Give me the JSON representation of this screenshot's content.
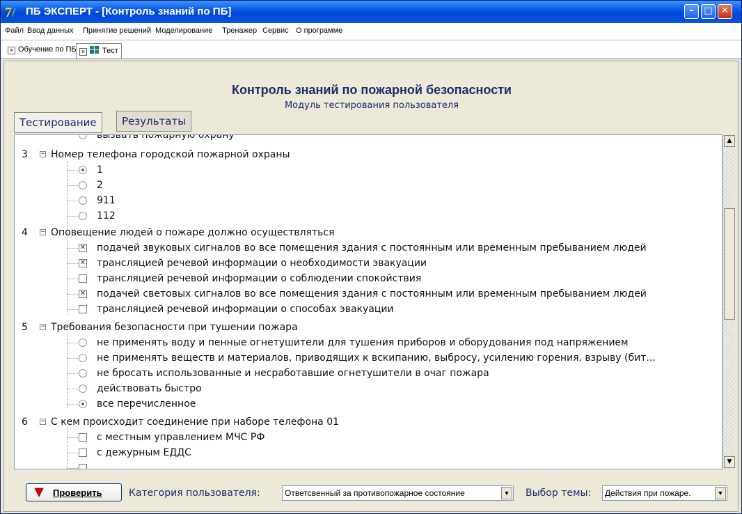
{
  "window": {
    "title": "ПБ ЭКСПЕРТ - [Контроль знаний по ПБ]",
    "minimize": "–",
    "maximize": "□",
    "close": "✕"
  },
  "menu": [
    "Файл",
    "Ввод данных",
    "Принятие решений",
    "Моделирование",
    "Тренажер",
    "Сервис",
    "О программе"
  ],
  "doc_tabs": [
    {
      "label": "Обучение по ПБ",
      "active": false
    },
    {
      "label": "Тест",
      "active": true
    }
  ],
  "header": {
    "title": "Контроль знаний по пожарной безопасности",
    "subtitle": "Модуль тестирования пользователя"
  },
  "mode_tabs": [
    {
      "label": "Тестирование",
      "active": true
    },
    {
      "label": "Результаты",
      "active": false
    }
  ],
  "tree": {
    "partial_top": "вызвать пожарную охрану",
    "questions": [
      {
        "num": "3",
        "text": "Номер телефона городской пожарной охраны",
        "type": "radio",
        "options": [
          {
            "text": "1",
            "checked": true
          },
          {
            "text": "2",
            "checked": false
          },
          {
            "text": "911",
            "checked": false
          },
          {
            "text": "112",
            "checked": false
          }
        ]
      },
      {
        "num": "4",
        "text": "Оповещение людей о пожаре должно осуществляться",
        "type": "checkbox",
        "options": [
          {
            "text": "подачей звуковых сигналов во все помещения здания с постоянным или временным пребыванием людей",
            "checked": true
          },
          {
            "text": "трансляцией речевой информации о необходимости эвакуации",
            "checked": true
          },
          {
            "text": "трансляцией речевой информации о соблюдении спокойствия",
            "checked": false
          },
          {
            "text": "подачей световых сигналов во все помещения здания с постоянным или временным пребыванием людей",
            "checked": true
          },
          {
            "text": "трансляцией речевой информации о способах эвакуации",
            "checked": false
          }
        ]
      },
      {
        "num": "5",
        "text": "Требования безопасности при тушении пожара",
        "type": "radio",
        "options": [
          {
            "text": "не применять воду и пенные огнетушители для тушения приборов и оборудования под напряжением",
            "checked": false
          },
          {
            "text": "не применять веществ и материалов, приводящих к вскипанию, выбросу, усилению горения, взрыву (бит...",
            "checked": false
          },
          {
            "text": "не бросать использованные и несработавшие огнетушители в очаг пожара",
            "checked": false
          },
          {
            "text": "действовать быстро",
            "checked": false
          },
          {
            "text": "все перечисленное",
            "checked": true
          }
        ]
      },
      {
        "num": "6",
        "text": "С кем происходит соединение при наборе телефона 01",
        "type": "checkbox",
        "options": [
          {
            "text": "с местным управлением МЧС РФ",
            "checked": false
          },
          {
            "text": "с дежурным ЕДДС",
            "checked": false
          }
        ]
      }
    ]
  },
  "bottom": {
    "check_button": "Проверить",
    "category_label": "Категория пользователя:",
    "category_value": "Ответсвенный за противопожарное состояние",
    "topic_label": "Выбор темы:",
    "topic_value": "Действия при пожаре."
  },
  "colors": {
    "titlebar": "#0046d5",
    "heading": "#1c2c6c",
    "flag": "#d40000"
  }
}
